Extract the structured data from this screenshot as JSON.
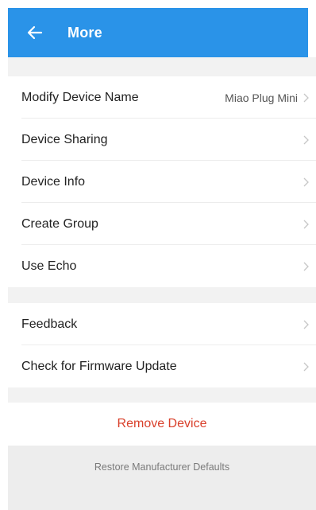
{
  "colors": {
    "accent": "#2a93e8",
    "danger": "#d9402b"
  },
  "header": {
    "back_icon": "arrow-left-icon",
    "title": "More"
  },
  "settings_group_1": [
    {
      "label": "Modify Device Name",
      "value": "Miao Plug Mini"
    },
    {
      "label": "Device Sharing"
    },
    {
      "label": "Device Info"
    },
    {
      "label": "Create Group"
    },
    {
      "label": "Use Echo"
    }
  ],
  "settings_group_2": [
    {
      "label": "Feedback"
    },
    {
      "label": "Check for Firmware Update"
    }
  ],
  "actions": {
    "remove_device": "Remove Device",
    "restore_defaults": "Restore Manufacturer Defaults"
  },
  "icons": {
    "row_chevron": "chevron-right-icon"
  }
}
